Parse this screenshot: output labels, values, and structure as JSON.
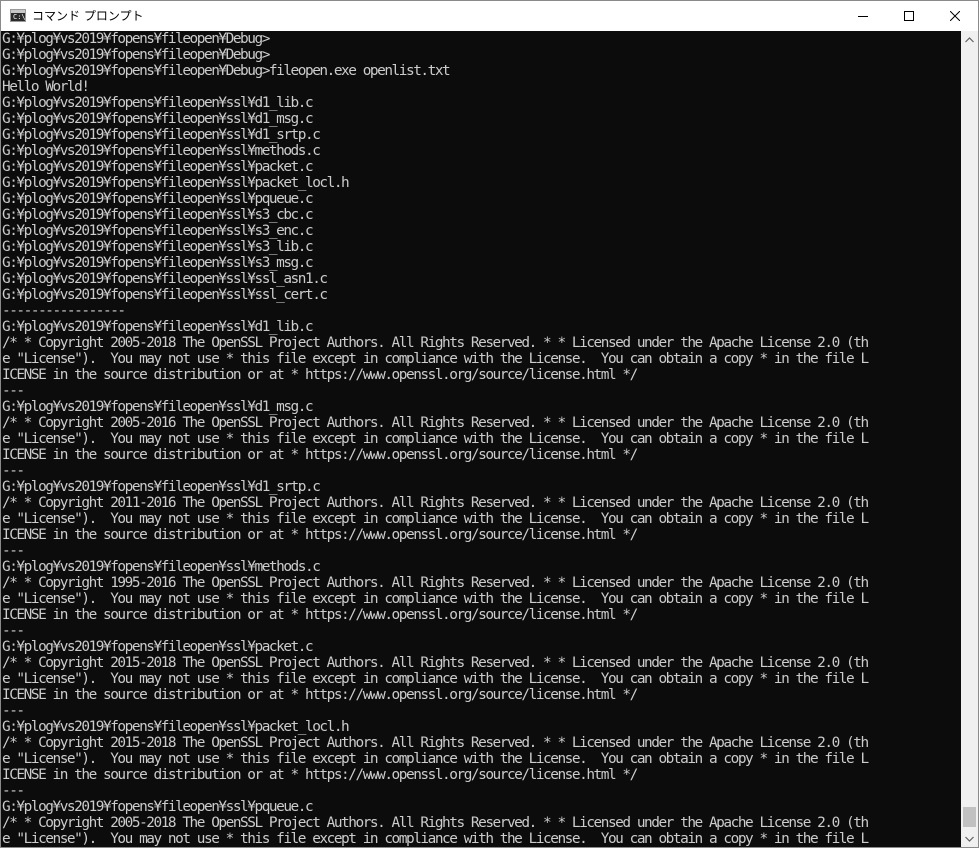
{
  "window": {
    "title": "コマンド プロンプト",
    "icon_label": "C:\\"
  },
  "controls": {
    "minimize": "minimize-icon",
    "maximize": "maximize-icon",
    "close": "close-icon"
  },
  "colors": {
    "console_bg": "#0c0c0c",
    "console_fg": "#cccccc",
    "titlebar_bg": "#ffffff",
    "scrollbar_bg": "#f0f0f0",
    "scroll_thumb": "#c1c1c1"
  },
  "console": {
    "lines": [
      "G:¥plog¥vs2019¥fopens¥fileopen¥Debug>",
      "G:¥plog¥vs2019¥fopens¥fileopen¥Debug>",
      "G:¥plog¥vs2019¥fopens¥fileopen¥Debug>fileopen.exe openlist.txt",
      "Hello World!",
      "G:¥plog¥vs2019¥fopens¥fileopen¥ssl¥d1_lib.c",
      "G:¥plog¥vs2019¥fopens¥fileopen¥ssl¥d1_msg.c",
      "G:¥plog¥vs2019¥fopens¥fileopen¥ssl¥d1_srtp.c",
      "G:¥plog¥vs2019¥fopens¥fileopen¥ssl¥methods.c",
      "G:¥plog¥vs2019¥fopens¥fileopen¥ssl¥packet.c",
      "G:¥plog¥vs2019¥fopens¥fileopen¥ssl¥packet_locl.h",
      "G:¥plog¥vs2019¥fopens¥fileopen¥ssl¥pqueue.c",
      "G:¥plog¥vs2019¥fopens¥fileopen¥ssl¥s3_cbc.c",
      "G:¥plog¥vs2019¥fopens¥fileopen¥ssl¥s3_enc.c",
      "G:¥plog¥vs2019¥fopens¥fileopen¥ssl¥s3_lib.c",
      "G:¥plog¥vs2019¥fopens¥fileopen¥ssl¥s3_msg.c",
      "G:¥plog¥vs2019¥fopens¥fileopen¥ssl¥ssl_asn1.c",
      "G:¥plog¥vs2019¥fopens¥fileopen¥ssl¥ssl_cert.c",
      "-----------------",
      "G:¥plog¥vs2019¥fopens¥fileopen¥ssl¥d1_lib.c",
      "/* * Copyright 2005-2018 The OpenSSL Project Authors. All Rights Reserved. * * Licensed under the Apache License 2.0 (th",
      "e \"License\").  You may not use * this file except in compliance with the License.  You can obtain a copy * in the file L",
      "ICENSE in the source distribution or at * https://www.openssl.org/source/license.html */",
      "---",
      "G:¥plog¥vs2019¥fopens¥fileopen¥ssl¥d1_msg.c",
      "/* * Copyright 2005-2016 The OpenSSL Project Authors. All Rights Reserved. * * Licensed under the Apache License 2.0 (th",
      "e \"License\").  You may not use * this file except in compliance with the License.  You can obtain a copy * in the file L",
      "ICENSE in the source distribution or at * https://www.openssl.org/source/license.html */",
      "---",
      "G:¥plog¥vs2019¥fopens¥fileopen¥ssl¥d1_srtp.c",
      "/* * Copyright 2011-2016 The OpenSSL Project Authors. All Rights Reserved. * * Licensed under the Apache License 2.0 (th",
      "e \"License\").  You may not use * this file except in compliance with the License.  You can obtain a copy * in the file L",
      "ICENSE in the source distribution or at * https://www.openssl.org/source/license.html */",
      "---",
      "G:¥plog¥vs2019¥fopens¥fileopen¥ssl¥methods.c",
      "/* * Copyright 1995-2016 The OpenSSL Project Authors. All Rights Reserved. * * Licensed under the Apache License 2.0 (th",
      "e \"License\").  You may not use * this file except in compliance with the License.  You can obtain a copy * in the file L",
      "ICENSE in the source distribution or at * https://www.openssl.org/source/license.html */",
      "---",
      "G:¥plog¥vs2019¥fopens¥fileopen¥ssl¥packet.c",
      "/* * Copyright 2015-2018 The OpenSSL Project Authors. All Rights Reserved. * * Licensed under the Apache License 2.0 (th",
      "e \"License\").  You may not use * this file except in compliance with the License.  You can obtain a copy * in the file L",
      "ICENSE in the source distribution or at * https://www.openssl.org/source/license.html */",
      "---",
      "G:¥plog¥vs2019¥fopens¥fileopen¥ssl¥packet_locl.h",
      "/* * Copyright 2015-2018 The OpenSSL Project Authors. All Rights Reserved. * * Licensed under the Apache License 2.0 (th",
      "e \"License\").  You may not use * this file except in compliance with the License.  You can obtain a copy * in the file L",
      "ICENSE in the source distribution or at * https://www.openssl.org/source/license.html */",
      "---",
      "G:¥plog¥vs2019¥fopens¥fileopen¥ssl¥pqueue.c",
      "/* * Copyright 2005-2018 The OpenSSL Project Authors. All Rights Reserved. * * Licensed under the Apache License 2.0 (th",
      "e \"License\").  You may not use * this file except in compliance with the License.  You can obtain a copy * in the file L"
    ]
  }
}
